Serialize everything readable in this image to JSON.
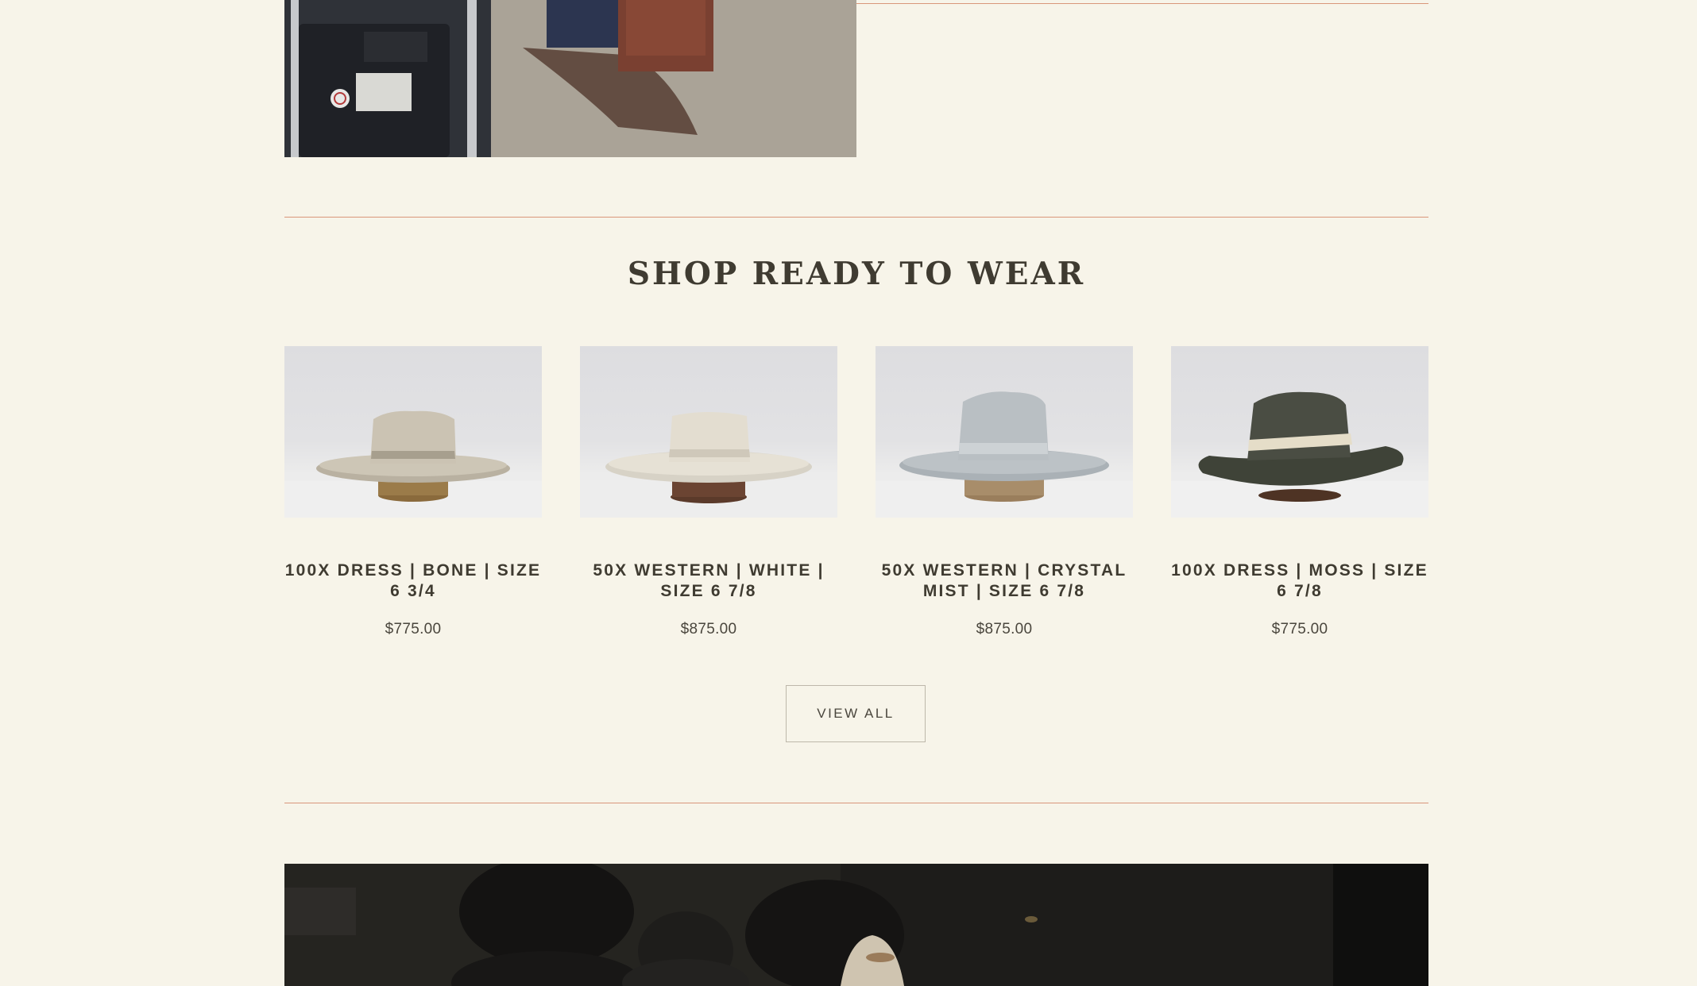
{
  "section": {
    "title": "SHOP READY TO WEAR"
  },
  "products": [
    {
      "name": "100X DRESS | BONE | SIZE 6 3/4",
      "price": "$775.00",
      "hat_color": "#c9c2b3",
      "band_color": "#b8ae9c",
      "icon": "bone-hat-photo"
    },
    {
      "name": "50X WESTERN | WHITE | SIZE 6 7/8",
      "price": "$875.00",
      "hat_color": "#e3ded2",
      "band_color": "#d2ccbe",
      "icon": "white-hat-photo"
    },
    {
      "name": "50X WESTERN | CRYSTAL MIST | SIZE 6 7/8",
      "price": "$875.00",
      "hat_color": "#b9bfc3",
      "band_color": "#c8cdd0",
      "icon": "crystal-mist-hat-photo"
    },
    {
      "name": "100X DRESS | MOSS | SIZE 6 7/8",
      "price": "$775.00",
      "hat_color": "#4a4d43",
      "band_color": "#e5ddc8",
      "icon": "moss-hat-photo"
    }
  ],
  "view_all": {
    "label": "VIEW ALL"
  },
  "colors": {
    "background": "#f7f4e9",
    "rule": "#d9967a",
    "text": "#3f3b31"
  }
}
